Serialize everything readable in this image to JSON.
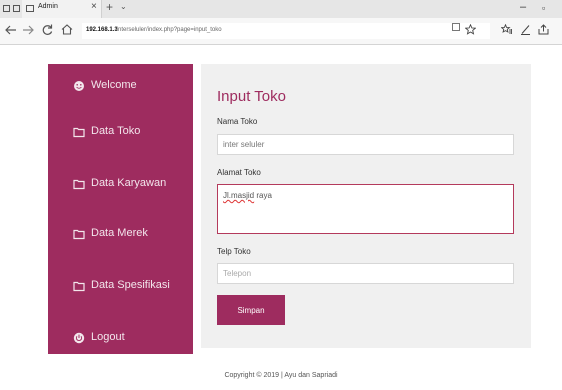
{
  "browser": {
    "tab_title": "Admin",
    "tab_close": "×",
    "new_tab": "+",
    "tab_list": "⌄",
    "url_host": "192.168.1.3",
    "url_path": "/interseluler/index.php?page=input_toko",
    "minimize": "–",
    "maximize": "▫",
    "icons": [
      "back-arrow-icon",
      "forward-arrow-icon",
      "refresh-icon",
      "home-icon",
      "reading-view-icon",
      "star-icon",
      "favorites-icon",
      "pen-icon",
      "share-icon"
    ]
  },
  "sidebar": {
    "items": [
      {
        "label": "Welcome",
        "icon": "smiley-icon"
      },
      {
        "label": "Data Toko",
        "icon": "folder-icon"
      },
      {
        "label": "Data Karyawan",
        "icon": "folder-icon"
      },
      {
        "label": "Data Merek",
        "icon": "folder-icon"
      },
      {
        "label": "Data Spesifikasi",
        "icon": "folder-icon"
      },
      {
        "label": "Logout",
        "icon": "power-icon"
      }
    ],
    "color": "#9e2c5f"
  },
  "form": {
    "title": "Input Toko",
    "nama_label": "Nama Toko",
    "nama_value": "inter seluler",
    "alamat_label": "Alamat Toko",
    "alamat_value_word1": "Jl.masjid",
    "alamat_value_word2": " raya",
    "telp_label": "Telp Toko",
    "telp_placeholder": "Telepon",
    "submit_label": "Simpan"
  },
  "footer": {
    "copyright": "Copyright © 2019 | Ayu dan Sapriadi"
  }
}
